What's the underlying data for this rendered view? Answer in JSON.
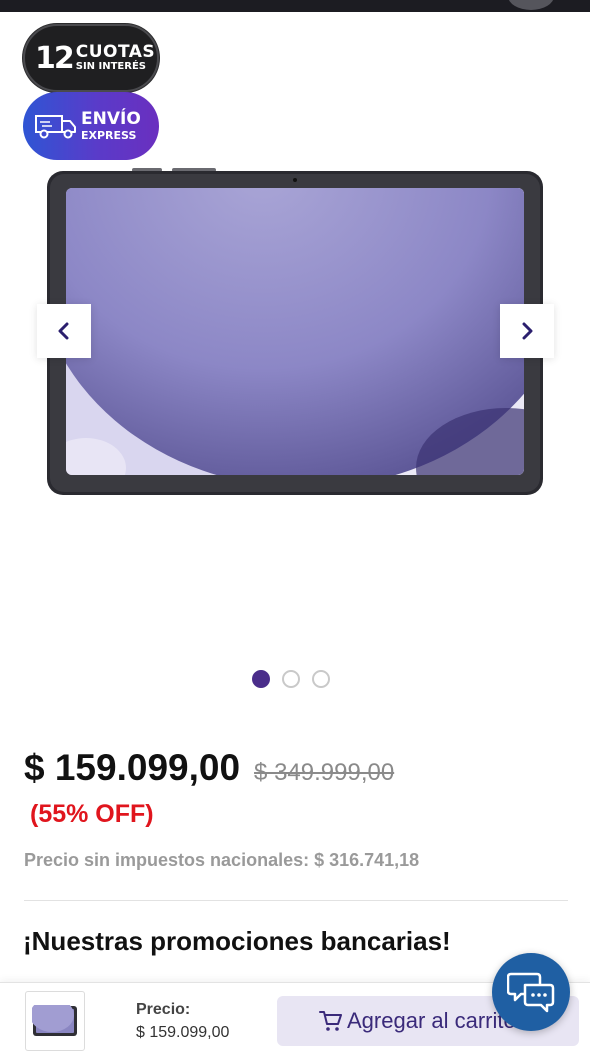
{
  "badges": {
    "cuotas_number": "12",
    "cuotas_line1": "CUOTAS",
    "cuotas_line2": "SIN INTERÉS",
    "envio_line1": "ENVÍO",
    "envio_line2": "EXPRESS",
    "cuotas_color": "#1f1f21",
    "envio_gradient": [
      "#2f55d4",
      "#6a2fbf"
    ]
  },
  "gallery": {
    "image_icon": "tablet-product-image",
    "prev_icon": "chevron-left-icon",
    "next_icon": "chevron-right-icon",
    "slide_count": 3,
    "active_slide": 1
  },
  "product": {
    "price": "$ 159.099,00",
    "original_price": "$ 349.999,00",
    "discount": "(55% OFF)",
    "tax_note": "Precio sin impuestos nacionales: $ 316.741,18",
    "discount_color": "#e0151d"
  },
  "promotions": {
    "title": "¡Nuestras promociones bancarias!"
  },
  "bottom_bar": {
    "price_label": "Precio:",
    "price_value": "$ 159.099,00",
    "add_to_cart_label": "Agregar al carrito",
    "button_color": "#e8e5f3"
  },
  "chat": {
    "icon": "chat-bubbles-icon",
    "color": "#1f5fa3"
  },
  "theme": {
    "accent": "#4a2d8a"
  }
}
